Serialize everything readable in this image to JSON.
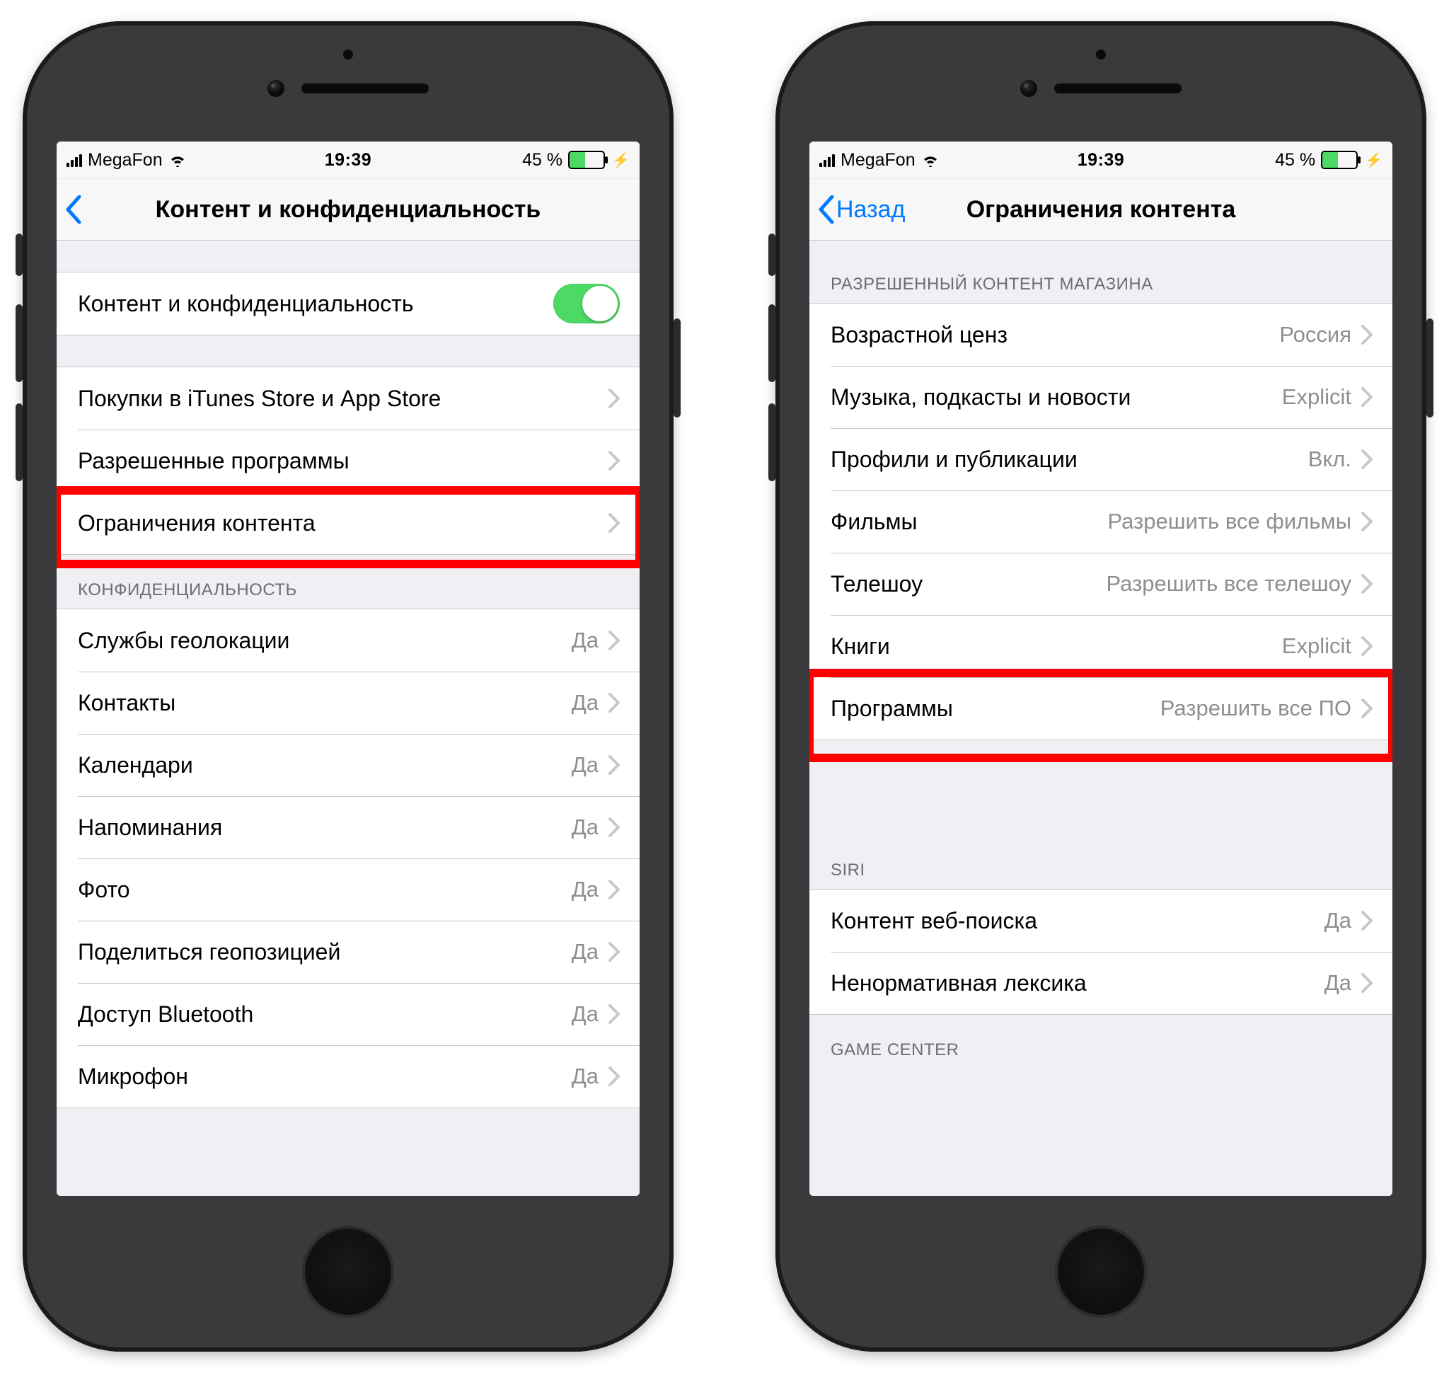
{
  "statusbar": {
    "carrier": "MegaFon",
    "time": "19:39",
    "battery_text": "45 %"
  },
  "left_screen": {
    "nav": {
      "title": "Контент и конфиденциальность",
      "back": ""
    },
    "toggle_row": {
      "label": "Контент и конфиденциальность"
    },
    "group1": {
      "items": [
        {
          "label": "Покупки в iTunes Store и App Store",
          "value": ""
        },
        {
          "label": "Разрешенные программы",
          "value": ""
        },
        {
          "label": "Ограничения контента",
          "value": ""
        }
      ]
    },
    "privacy_header": "КОНФИДЕНЦИАЛЬНОСТЬ",
    "privacy_items": [
      {
        "label": "Службы геолокации",
        "value": "Да"
      },
      {
        "label": "Контакты",
        "value": "Да"
      },
      {
        "label": "Календари",
        "value": "Да"
      },
      {
        "label": "Напоминания",
        "value": "Да"
      },
      {
        "label": "Фото",
        "value": "Да"
      },
      {
        "label": "Поделиться геопозицией",
        "value": "Да"
      },
      {
        "label": "Доступ Bluetooth",
        "value": "Да"
      },
      {
        "label": "Микрофон",
        "value": "Да"
      }
    ]
  },
  "right_screen": {
    "nav": {
      "title": "Ограничения контента",
      "back": "Назад"
    },
    "store_header": "РАЗРЕШЕННЫЙ КОНТЕНТ МАГАЗИНА",
    "store_items": [
      {
        "label": "Возрастной ценз",
        "value": "Россия"
      },
      {
        "label": "Музыка, подкасты и новости",
        "value": "Explicit"
      },
      {
        "label": "Профили и публикации",
        "value": "Вкл."
      },
      {
        "label": "Фильмы",
        "value": "Разрешить все фильмы"
      },
      {
        "label": "Телешоу",
        "value": "Разрешить все телешоу"
      },
      {
        "label": "Книги",
        "value": "Explicit"
      },
      {
        "label": "Программы",
        "value": "Разрешить все ПО"
      }
    ],
    "siri_header": "SIRI",
    "siri_items": [
      {
        "label": "Контент веб-поиска",
        "value": "Да"
      },
      {
        "label": "Ненормативная лексика",
        "value": "Да"
      }
    ],
    "gc_header": "GAME CENTER"
  }
}
